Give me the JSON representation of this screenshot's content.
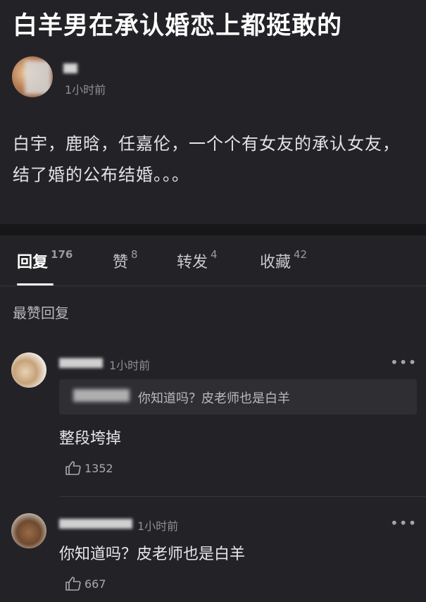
{
  "post": {
    "title": "白羊男在承认婚恋上都挺敢的",
    "time": "1小时前",
    "body": "白宇，鹿晗，任嘉伦，一个个有女友的承认女友，结了婚的公布结婚。。。"
  },
  "tabs": [
    {
      "label": "回复",
      "count": "176",
      "active": true
    },
    {
      "label": "赞",
      "count": "8",
      "active": false
    },
    {
      "label": "转发",
      "count": "4",
      "active": false
    },
    {
      "label": "收藏",
      "count": "42",
      "active": false
    }
  ],
  "section_label": "最赞回复",
  "comments": [
    {
      "time": "1小时前",
      "quote": "你知道吗？皮老师也是白羊",
      "text": "整段垮掉",
      "likes": "1352",
      "more": "•••"
    },
    {
      "time": "1小时前",
      "text": "你知道吗？皮老师也是白羊",
      "likes": "667",
      "more": "•••"
    }
  ],
  "colors": {
    "background": "#232327",
    "divider": "#17171a",
    "quote_bg": "#2e2e33"
  }
}
